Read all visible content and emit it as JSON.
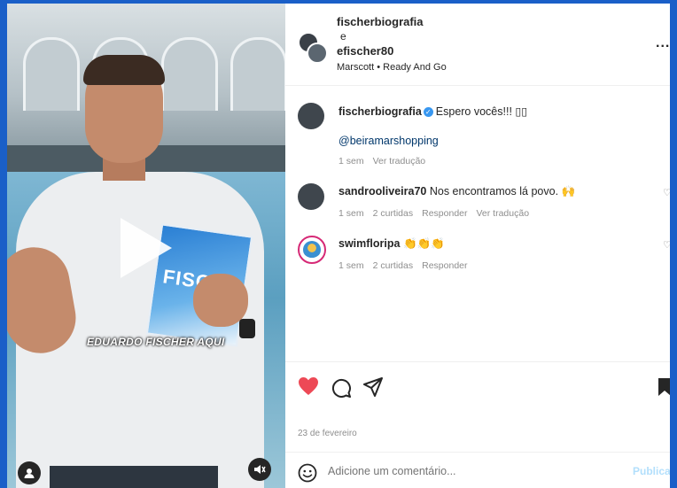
{
  "video": {
    "caption": "EDUARDO FISCHER AQUI",
    "book_title": "FISC"
  },
  "header": {
    "user1": "fischerbiografia",
    "conjunction": "e",
    "user2": "efischer80",
    "audio": "Marscott • Ready And Go",
    "more": "..."
  },
  "comments": [
    {
      "user": "fischerbiografia",
      "text": "Espero vocês!!! ▯▯",
      "mention": "@beiramarshopping",
      "time": "1 sem",
      "translate": "Ver tradução"
    },
    {
      "user": "sandrooliveira70",
      "text": "Nos encontramos lá povo. 🙌",
      "time": "1 sem",
      "likes": "2 curtidas",
      "reply": "Responder",
      "translate": "Ver tradução"
    },
    {
      "user": "swimfloripa",
      "text": "👏👏👏",
      "time": "1 sem",
      "likes": "2 curtidas",
      "reply": "Responder"
    }
  ],
  "post_date": "23 de fevereiro",
  "add_comment": {
    "placeholder": "Adicione um comentário...",
    "publish": "Publicar"
  },
  "colors": {
    "like": "#ed4956",
    "link": "#00376b",
    "frame": "#1a5fc8"
  }
}
